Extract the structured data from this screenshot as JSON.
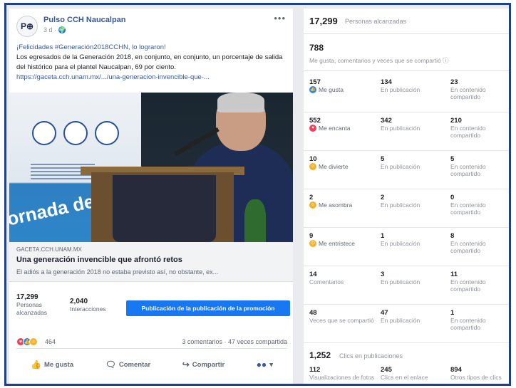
{
  "post": {
    "page_name": "Pulso CCH Naucalpan",
    "avatar_text": "P⊕",
    "meta": "3 d · 🌍",
    "more": "•••",
    "text_line1": "¡Felicidades #Generación2018CCHN, lo lograron!",
    "text_line2": "Los egresados de la Generación 2018, en conjunto, en conjunto, un porcentaje de salida del histórico para el plantel Naucalpan, 69 por ciento.",
    "link_url": "https://gaceta.cch.unam.mx/.../una-generacion-invencible-que-...",
    "photo_banner_text": "ornada de",
    "link_source": "GACETA.CCH.UNAM.MX",
    "link_title": "Una generación invencible que afrontó retos",
    "link_desc": "El adiós a la generación 2018 no estaba previsto así, no obstante, ex...",
    "people_reached_num": "17,299",
    "people_reached_lbl1": "Personas",
    "people_reached_lbl2": "alcanzadas",
    "interactions_num": "2,040",
    "interactions_lbl": "Interacciones",
    "boost_label": "Publicación de la publicación de la promoción",
    "reactions_count": "464",
    "comments_shares": "3 comentarios · 47 veces compartida",
    "actions": {
      "like": "Me gusta",
      "comment": "Comentar",
      "share": "Compartir",
      "menu": "▾"
    }
  },
  "insights": {
    "reach_num": "17,299",
    "reach_lbl": "Personas alcanzadas",
    "total_num": "788",
    "total_lbl": "Me gusta, comentarios y veces que se compartió ⓘ",
    "rows": [
      {
        "c1n": "157",
        "c1l": "Me gusta",
        "icon": "like",
        "c2n": "134",
        "c2l": "En publicación",
        "c3n": "23",
        "c3l": "En contenido compartido"
      },
      {
        "c1n": "552",
        "c1l": "Me encanta",
        "icon": "love",
        "c2n": "342",
        "c2l": "En publicación",
        "c3n": "210",
        "c3l": "En contenido compartido"
      },
      {
        "c1n": "10",
        "c1l": "Me divierte",
        "icon": "haha",
        "c2n": "5",
        "c2l": "En publicación",
        "c3n": "5",
        "c3l": "En contenido compartido"
      },
      {
        "c1n": "2",
        "c1l": "Me asombra",
        "icon": "wow",
        "c2n": "2",
        "c2l": "En publicación",
        "c3n": "0",
        "c3l": "En contenido compartido"
      },
      {
        "c1n": "9",
        "c1l": "Me entristece",
        "icon": "sad",
        "c2n": "1",
        "c2l": "En publicación",
        "c3n": "8",
        "c3l": "En contenido compartido"
      },
      {
        "c1n": "14",
        "c1l": "Comentarios",
        "icon": "",
        "c2n": "3",
        "c2l": "En publicación",
        "c3n": "11",
        "c3l": "En contenido compartido"
      },
      {
        "c1n": "48",
        "c1l": "Veces que se compartió",
        "icon": "",
        "c2n": "47",
        "c2l": "En publicación",
        "c3n": "1",
        "c3l": "En contenido compartido"
      }
    ],
    "clicks_num": "1,252",
    "clicks_lbl": "Clics en publicaciones",
    "click_row": {
      "c1n": "112",
      "c1l": "Visualizaciones de fotos",
      "c2n": "245",
      "c2l": "Clics en el enlace",
      "c3n": "894",
      "c3l": "Otros tipos de clics"
    }
  },
  "colors": {
    "frame": "#1f3f8f",
    "accent": "#1877f2",
    "like": "#2d88ff",
    "love": "#f33e58",
    "haha": "#f7b125"
  }
}
